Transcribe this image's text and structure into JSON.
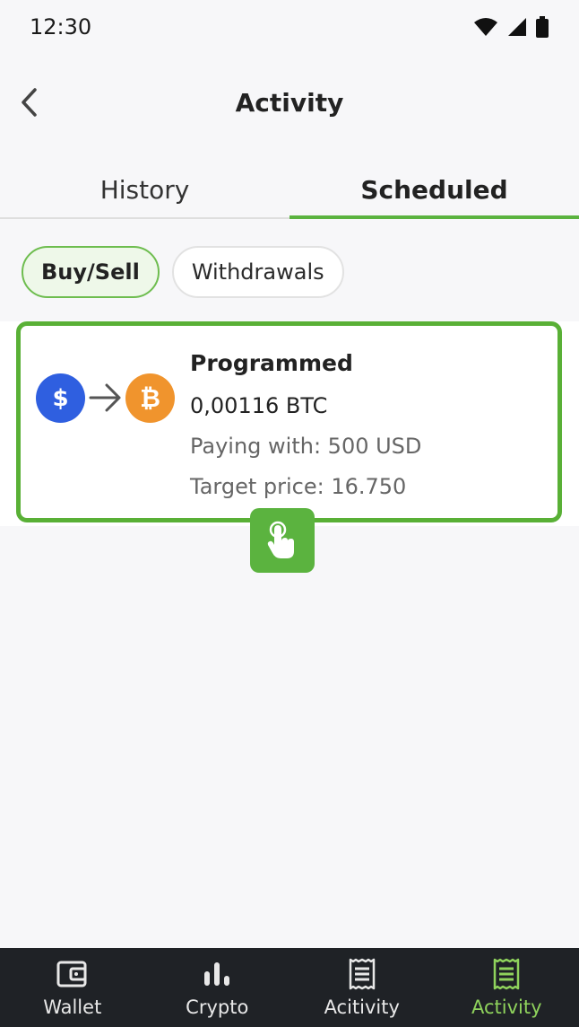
{
  "status_bar": {
    "time": "12:30"
  },
  "header": {
    "title": "Activity"
  },
  "tabs": [
    {
      "label": "History",
      "active": false
    },
    {
      "label": "Scheduled",
      "active": true
    }
  ],
  "filters": [
    {
      "label": "Buy/Sell",
      "active": true
    },
    {
      "label": "Withdrawals",
      "active": false
    }
  ],
  "order": {
    "from_icon": "dollar-coin-icon",
    "to_icon": "bitcoin-coin-icon",
    "from_symbol": "$",
    "to_symbol": "₿",
    "status": "Programmed",
    "amount": "0,00116 BTC",
    "paying_with": "Paying with: 500 USD",
    "target_price": "Target price: 16.750"
  },
  "bottom_nav": [
    {
      "label": "Wallet",
      "icon": "wallet-icon",
      "active": false
    },
    {
      "label": "Crypto",
      "icon": "bar-chart-icon",
      "active": false
    },
    {
      "label": "Acitivity",
      "icon": "receipt-icon",
      "active": false
    },
    {
      "label": "Activity",
      "icon": "receipt-icon",
      "active": true
    }
  ],
  "colors": {
    "accent": "#5bb33f",
    "usd_coin": "#2f5fe0",
    "btc_coin": "#f0942d",
    "nav_background": "#1f2226",
    "nav_active": "#8fd35c"
  }
}
